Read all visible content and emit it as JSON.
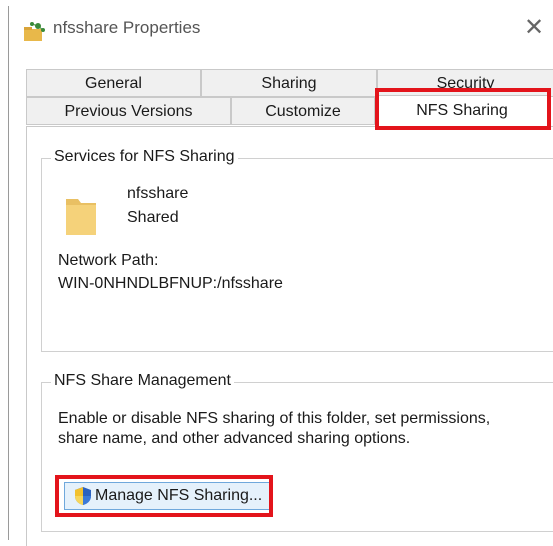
{
  "window": {
    "title": "nfsshare Properties",
    "close_glyph": "✕",
    "icon": "shared-folder-icon"
  },
  "tabs": {
    "row1": [
      {
        "label": "General"
      },
      {
        "label": "Sharing"
      },
      {
        "label": "Security"
      }
    ],
    "row2": [
      {
        "label": "Previous Versions"
      },
      {
        "label": "Customize"
      },
      {
        "label": "NFS Sharing",
        "selected": true
      }
    ]
  },
  "services_group": {
    "title": "Services for NFS Sharing",
    "folder_name": "nfsshare",
    "status": "Shared",
    "network_path_label": "Network Path:",
    "network_path": "WIN-0NHNDLBFNUP:/nfsshare",
    "icon": "folder-icon"
  },
  "management_group": {
    "title": "NFS Share Management",
    "description_line1": "Enable or disable NFS sharing of this folder, set permissions,",
    "description_line2": "share name, and other advanced sharing options.",
    "button_label": "Manage NFS Sharing...",
    "button_icon": "uac-shield-icon"
  },
  "colors": {
    "highlight": "#e3141b",
    "folder": "#f5d27a",
    "button_bg": "#e5f1fb",
    "button_border": "#6fa8dc"
  }
}
